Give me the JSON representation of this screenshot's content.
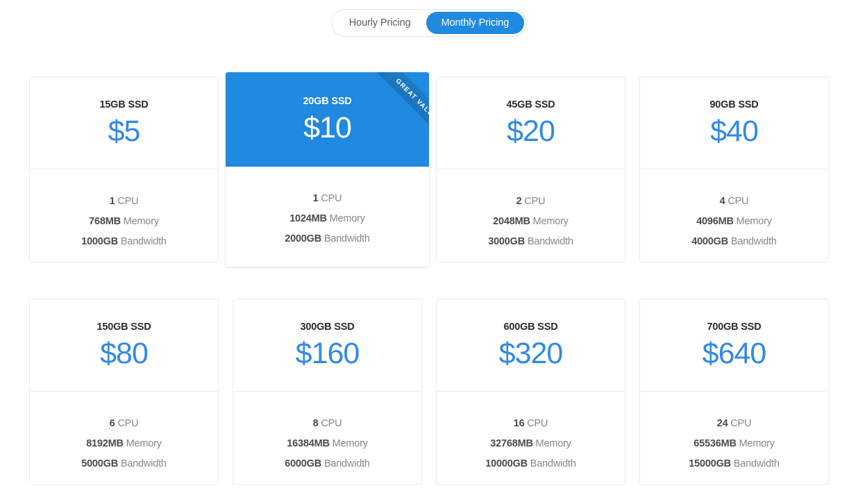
{
  "toggle": {
    "options": [
      {
        "label": "Hourly Pricing",
        "active": false
      },
      {
        "label": "Monthly Pricing",
        "active": true
      }
    ]
  },
  "colors": {
    "accent": "#2089e0",
    "price": "#3189e8",
    "title": "#2b2b30",
    "spec_value": "#4a4a52",
    "spec_label": "#85868e",
    "card_border": "#ececec",
    "background": "#ffffff"
  },
  "spec_labels": {
    "cpu": "CPU",
    "memory": "Memory",
    "bandwidth": "Bandwidth"
  },
  "ribbon": {
    "label": "GREAT VALUE"
  },
  "plans": [
    {
      "title": "15GB SSD",
      "price": "$5",
      "cpu": "1",
      "memory": "768MB",
      "bandwidth": "1000GB",
      "featured": false
    },
    {
      "title": "20GB SSD",
      "price": "$10",
      "cpu": "1",
      "memory": "1024MB",
      "bandwidth": "2000GB",
      "featured": true
    },
    {
      "title": "45GB SSD",
      "price": "$20",
      "cpu": "2",
      "memory": "2048MB",
      "bandwidth": "3000GB",
      "featured": false
    },
    {
      "title": "90GB SSD",
      "price": "$40",
      "cpu": "4",
      "memory": "4096MB",
      "bandwidth": "4000GB",
      "featured": false
    },
    {
      "title": "150GB SSD",
      "price": "$80",
      "cpu": "6",
      "memory": "8192MB",
      "bandwidth": "5000GB",
      "featured": false
    },
    {
      "title": "300GB SSD",
      "price": "$160",
      "cpu": "8",
      "memory": "16384MB",
      "bandwidth": "6000GB",
      "featured": false
    },
    {
      "title": "600GB SSD",
      "price": "$320",
      "cpu": "16",
      "memory": "32768MB",
      "bandwidth": "10000GB",
      "featured": false
    },
    {
      "title": "700GB SSD",
      "price": "$640",
      "cpu": "24",
      "memory": "65536MB",
      "bandwidth": "15000GB",
      "featured": false
    }
  ]
}
